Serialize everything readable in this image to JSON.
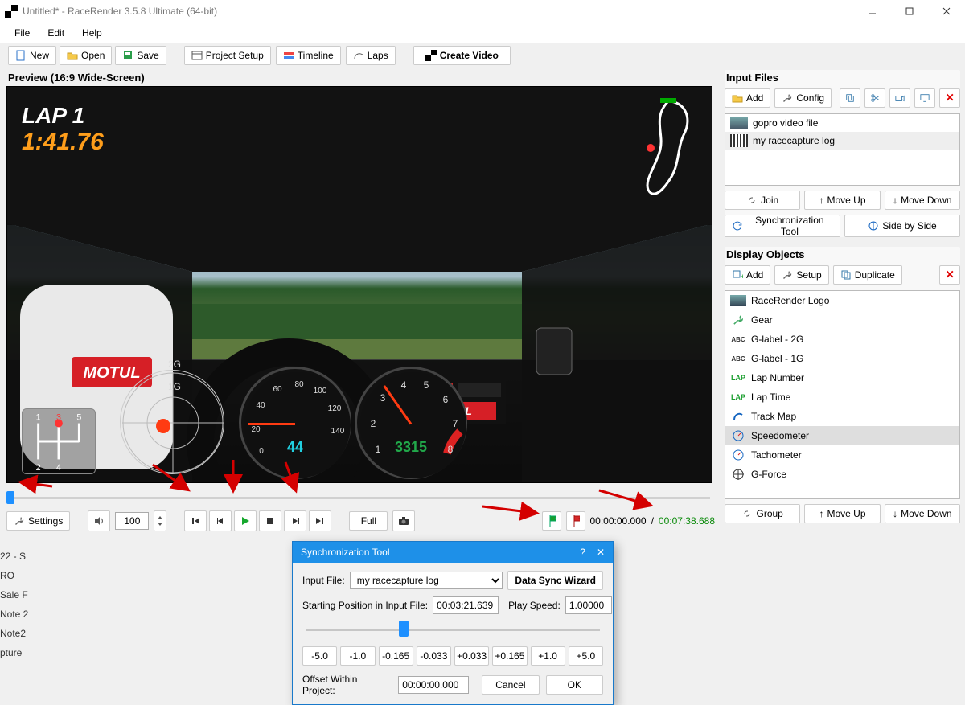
{
  "window": {
    "title": "Untitled* - RaceRender 3.5.8 Ultimate (64-bit)"
  },
  "menu": {
    "file": "File",
    "edit": "Edit",
    "help": "Help"
  },
  "toolbar": {
    "new": "New",
    "open": "Open",
    "save": "Save",
    "project_setup": "Project Setup",
    "timeline": "Timeline",
    "laps": "Laps",
    "create_video": "Create Video"
  },
  "preview": {
    "label": "Preview (16:9 Wide-Screen)",
    "lap_label": "LAP 1",
    "lap_time": "1:41.76",
    "g_labels": {
      "g1": "1G",
      "g2": "2G"
    },
    "speed_value": "44",
    "rpm_value": "3315",
    "gear_numbers": [
      "1",
      "2",
      "3",
      "4",
      "5"
    ],
    "tacho_ticks": [
      "1",
      "2",
      "3",
      "4",
      "5",
      "6",
      "7",
      "8"
    ],
    "speed_ticks": [
      "0",
      "20",
      "40",
      "60",
      "80",
      "100",
      "120",
      "140"
    ]
  },
  "transport": {
    "settings": "Settings",
    "volume_value": "100",
    "full": "Full",
    "time_current": "00:00:00.000",
    "time_total": "00:07:38.688"
  },
  "input_files": {
    "title": "Input Files",
    "add": "Add",
    "config": "Config",
    "items": [
      {
        "name": "gopro video file"
      },
      {
        "name": "my racecapture log"
      }
    ],
    "join": "Join",
    "move_up": "Move Up",
    "move_down": "Move Down",
    "sync_tool": "Synchronization Tool",
    "side_by_side": "Side by Side"
  },
  "display_objects": {
    "title": "Display Objects",
    "add": "Add",
    "setup": "Setup",
    "duplicate": "Duplicate",
    "items": [
      {
        "name": "RaceRender Logo",
        "icon": "logo"
      },
      {
        "name": "Gear",
        "icon": "wrench"
      },
      {
        "name": "G-label - 2G",
        "icon": "abc"
      },
      {
        "name": "G-label - 1G",
        "icon": "abc"
      },
      {
        "name": "Lap Number",
        "icon": "lap"
      },
      {
        "name": "Lap Time",
        "icon": "lap"
      },
      {
        "name": "Track Map",
        "icon": "track"
      },
      {
        "name": "Speedometer",
        "icon": "gauge",
        "selected": true
      },
      {
        "name": "Tachometer",
        "icon": "gauge"
      },
      {
        "name": "G-Force",
        "icon": "target"
      }
    ],
    "group": "Group",
    "move_up": "Move Up",
    "move_down": "Move Down"
  },
  "sync_dialog": {
    "title": "Synchronization Tool",
    "input_file_label": "Input File:",
    "input_file_value": "my racecapture log",
    "wizard": "Data Sync Wizard",
    "start_pos_label": "Starting Position in Input File:",
    "start_pos_value": "00:03:21.639",
    "play_speed_label": "Play Speed:",
    "play_speed_value": "1.00000",
    "nudge": [
      "-5.0",
      "-1.0",
      "-0.165",
      "-0.033",
      "+0.033",
      "+0.165",
      "+1.0",
      "+5.0"
    ],
    "offset_label": "Offset Within Project:",
    "offset_value": "00:00:00.000",
    "cancel": "Cancel",
    "ok": "OK"
  },
  "bg_strays": [
    "22 - S",
    "RO",
    "Sale F",
    "Note 2",
    "Note2",
    "pture"
  ]
}
